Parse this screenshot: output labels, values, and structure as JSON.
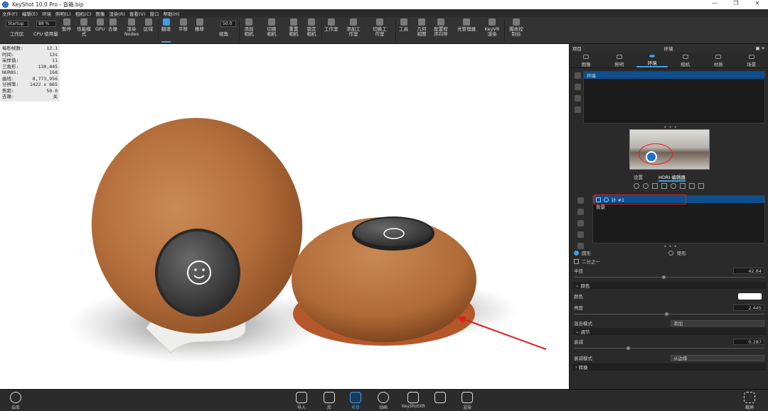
{
  "window": {
    "title": "KeyShot 10.0 Pro  - 音箱.bip",
    "controls": [
      "—",
      "❐",
      "✕"
    ]
  },
  "menu": [
    "文件(F)",
    "编辑(E)",
    "环境",
    "照明(L)",
    "相机(C)",
    "图像",
    "渲染(R)",
    "查看(V)",
    "窗口",
    "帮助(H)"
  ],
  "toolbar": {
    "workspace_value": "Startup",
    "workspace_label": "工作区",
    "cpu_value": "88 %",
    "cpu_label": "CPU 使用量",
    "fov_value": "50.0",
    "fov_label": "视角",
    "tools": [
      "暂停",
      "性能模式",
      "GPU",
      "去噪",
      "渲染 Nodes",
      "区域",
      "翻滚",
      "平移",
      "推移",
      "添加相机",
      "切换相机",
      "重置相机",
      "锁定相机",
      "工作室",
      "添加工作室",
      "切换工作室",
      "工具",
      "几何视图",
      "配置程序向导",
      "光管理器",
      "KeyVR 渲染",
      "脚本控制台"
    ]
  },
  "stats": [
    {
      "k": "每秒帧数:",
      "v": "12.1"
    },
    {
      "k": "时间:",
      "v": "13s"
    },
    {
      "k": "采样值:",
      "v": "11"
    },
    {
      "k": "三角形:",
      "v": "130,445"
    },
    {
      "k": "NURBS:",
      "v": "168"
    },
    {
      "k": "曲线:",
      "v": "8,773,956"
    },
    {
      "k": "分辨率:",
      "v": "1422 x 865"
    },
    {
      "k": "焦距:",
      "v": "50.0"
    },
    {
      "k": "去噪:",
      "v": "关"
    }
  ],
  "panel": {
    "left_title": "项目",
    "title": "环境",
    "tabs": [
      "图像",
      "照明",
      "环境",
      "相机",
      "材质",
      "场景"
    ],
    "active_tab": "环境",
    "env_list": [
      "环境"
    ],
    "subtabs": [
      "设置",
      "HDRI 编辑器"
    ],
    "pin_list": [
      "针 #1",
      "背景"
    ],
    "shape_options": [
      "圆形",
      "矩形"
    ],
    "half_label": "二分之一",
    "radius_label": "半径",
    "radius_value": "42.84",
    "color_section": "颜色",
    "color_label": "颜色",
    "color_swatch": "#ffffff",
    "brightness_label": "亮度",
    "brightness_value": "2.445",
    "blend_label": "混合模式",
    "blend_value": "添加",
    "adjust_section": "调节",
    "falloff_label": "衰减",
    "falloff_value": "0.287",
    "falloff_mode_label": "衰减模式",
    "falloff_mode_value": "从边缘",
    "transform_section": "转换"
  },
  "bottom": {
    "left": "云库",
    "items": [
      "导入",
      "库",
      "项目",
      "动画",
      "KeyShotXR",
      "",
      "渲染"
    ],
    "active": "项目",
    "right": "截屏"
  },
  "colors": {
    "accent": "#3aa0e8",
    "felt": "#b87240",
    "selection": "#0d4f8f",
    "annotation": "#e02020"
  }
}
